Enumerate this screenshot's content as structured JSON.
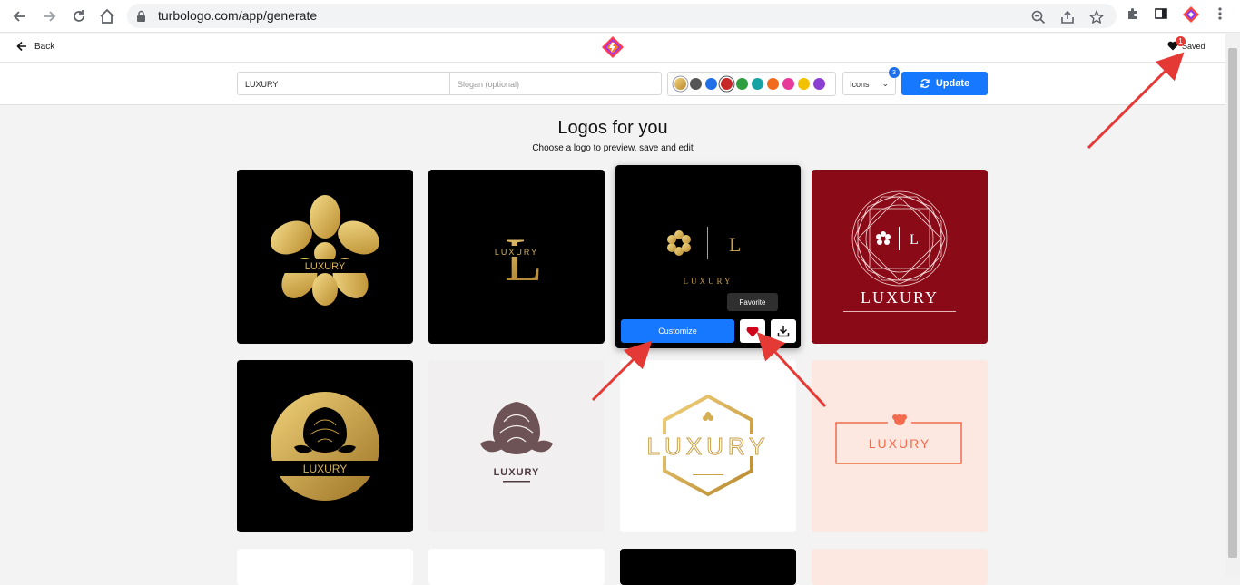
{
  "browser": {
    "url": "turbologo.com/app/generate",
    "icons": [
      "back-icon",
      "forward-icon",
      "reload-icon",
      "home-icon",
      "lock-icon",
      "zoom-icon",
      "share-icon",
      "star-icon",
      "puzzle-icon",
      "sidebar-icon",
      "profile-icon",
      "more-icon"
    ]
  },
  "header": {
    "back_label": "Back",
    "saved_label": "Saved",
    "saved_count": "1"
  },
  "toolbar": {
    "brand_name": "LUXURY",
    "slogan_placeholder": "Slogan (optional)",
    "icons_label": "Icons",
    "icons_count": "3",
    "update_label": "Update",
    "colors": [
      "#d9b24c",
      "#555555",
      "#1e6fe8",
      "#c62828",
      "#2e9e3f",
      "#17a3a3",
      "#f26b1d",
      "#e83a9a",
      "#f2c200",
      "#8b3fd1"
    ],
    "selected_color_index": 3
  },
  "main": {
    "title": "Logos for you",
    "subtitle": "Choose a logo to preview, save and edit"
  },
  "logos": [
    {
      "bg": "#000000",
      "text": "LUXURY",
      "style": "gold flower with banner"
    },
    {
      "bg": "#000000",
      "text": "LUXURY",
      "letter": "L"
    },
    {
      "bg": "#000000",
      "text": "LUXURY",
      "letter": "L"
    },
    {
      "bg": "#8a0a17",
      "text": "LUXURY",
      "letter": "L"
    },
    {
      "bg": "#000000",
      "text": "LUXURY",
      "style": "gold circle rose"
    },
    {
      "bg": "#f1efef",
      "text": "LUXURY",
      "style": "mauve rose"
    },
    {
      "bg": "#ffffff",
      "text": "LUXURY",
      "style": "gold hexagon"
    },
    {
      "bg": "#fde7e1",
      "text": "LUXURY",
      "style": "coral frame"
    }
  ],
  "hover": {
    "customize_label": "Customize",
    "favorite_tooltip": "Favorite"
  }
}
